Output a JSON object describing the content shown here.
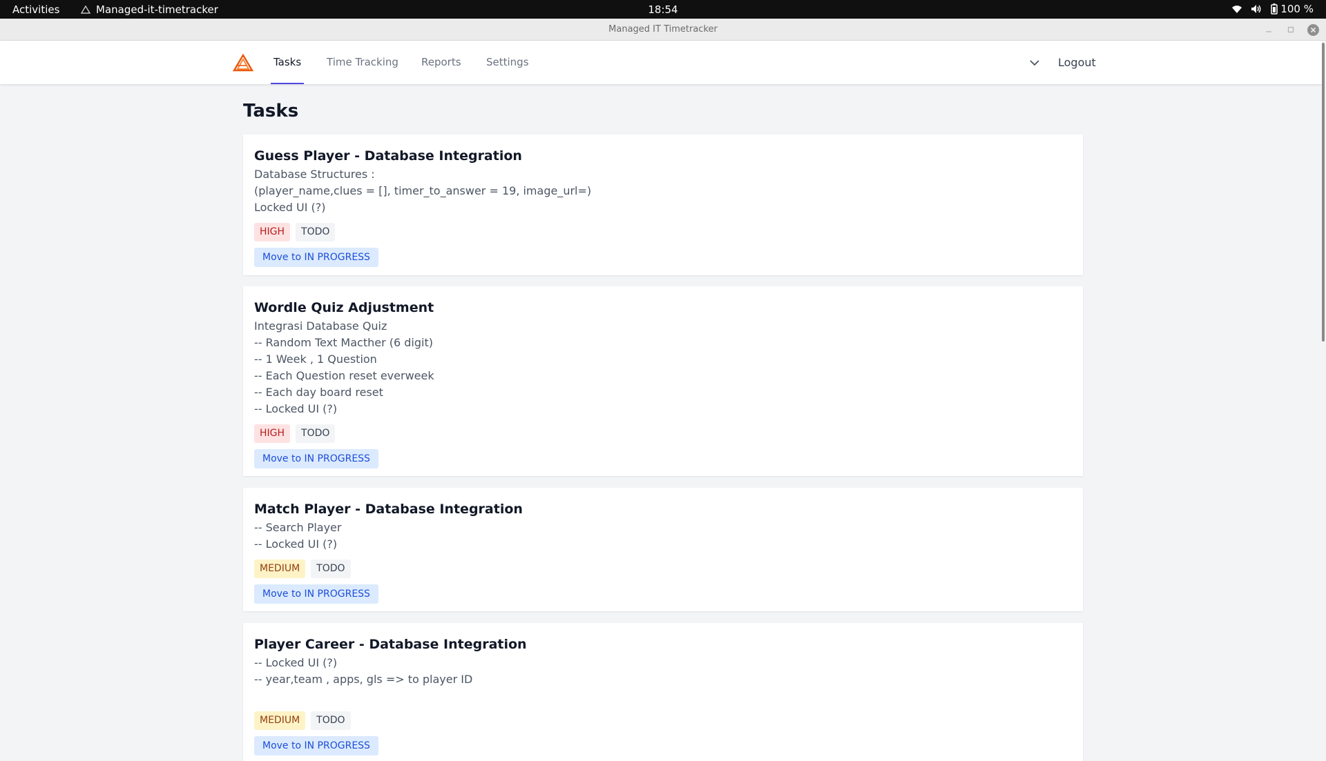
{
  "system": {
    "activities": "Activities",
    "app_name": "Managed-it-timetracker",
    "clock": "18:54",
    "battery": "100 %"
  },
  "window": {
    "title": "Managed IT Timetracker"
  },
  "nav": {
    "tabs": [
      "Tasks",
      "Time Tracking",
      "Reports",
      "Settings"
    ],
    "active_tab": "Tasks",
    "logout": "Logout"
  },
  "page": {
    "title": "Tasks"
  },
  "tasks": [
    {
      "title": "Guess Player - Database Integration",
      "description": [
        "Database Structures :",
        "(player_name,clues = [], timer_to_answer = 19, image_url=)",
        "Locked UI (?)"
      ],
      "priority": "HIGH",
      "status": "TODO",
      "action": "Move to IN PROGRESS"
    },
    {
      "title": "Wordle Quiz Adjustment",
      "description": [
        "Integrasi Database Quiz",
        "-- Random Text Macther (6 digit)",
        "-- 1 Week , 1 Question",
        "-- Each Question reset everweek",
        "-- Each day board reset",
        "-- Locked UI (?)"
      ],
      "priority": "HIGH",
      "status": "TODO",
      "action": "Move to IN PROGRESS"
    },
    {
      "title": "Match Player - Database Integration",
      "description": [
        "-- Search Player",
        "-- Locked UI (?)"
      ],
      "priority": "MEDIUM",
      "status": "TODO",
      "action": "Move to IN PROGRESS"
    },
    {
      "title": "Player Career - Database Integration",
      "description": [
        "-- Locked UI (?)",
        "-- year,team , apps, gls => to player ID",
        ""
      ],
      "priority": "MEDIUM",
      "status": "TODO",
      "action": "Move to IN PROGRESS"
    }
  ],
  "colors": {
    "accent": "#4f46e5",
    "high_bg": "#fee2e2",
    "medium_bg": "#fef3c7",
    "button_bg": "#dbeafe"
  }
}
